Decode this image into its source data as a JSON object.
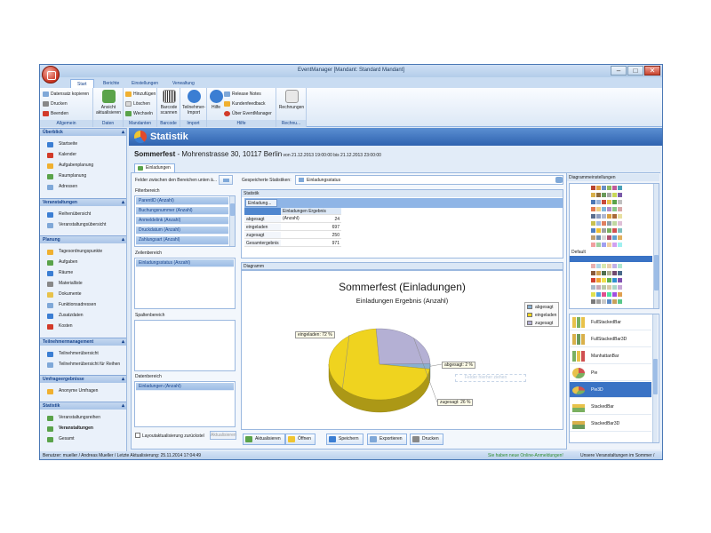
{
  "window": {
    "title": "EventManager [Mandant: Standard Mandant]",
    "min": "–",
    "max": "□",
    "close": "✕"
  },
  "ribbon": {
    "tabs": [
      "Start",
      "Berichte",
      "Einstellungen",
      "Verwaltung"
    ],
    "groups": {
      "allgemein": {
        "label": "Allgemein",
        "items": [
          "Datensatz kopieren",
          "Drucken",
          "Beenden"
        ]
      },
      "daten": {
        "label": "Daten",
        "button": "Ansicht aktualisieren"
      },
      "mandanten": {
        "label": "Mandanten",
        "items": [
          "Hinzufügen",
          "Löschen",
          "Wechseln"
        ]
      },
      "barcode": {
        "label": "Barcode",
        "button": "Barcode scannen"
      },
      "import": {
        "label": "Import",
        "button": "Teilnehmer-Import"
      },
      "hilfe": {
        "label": "Hilfe",
        "button": "Hilfe",
        "items": [
          "Release Notes",
          "Kundenfeedback",
          "Über EventManager"
        ]
      },
      "rechnungen": {
        "label": "Rechnu...",
        "button": "Rechnungen"
      }
    }
  },
  "sidebar": {
    "sections": [
      {
        "title": "Überblick",
        "items": [
          "Startseite",
          "Kalender",
          "Aufgabenplanung",
          "Raumplanung",
          "Adressen"
        ]
      },
      {
        "title": "Veranstaltungen",
        "items": [
          "Reihenübersicht",
          "Veranstaltungsübersicht"
        ]
      },
      {
        "title": "Planung",
        "items": [
          "Tagesordnungspunkte",
          "Aufgaben",
          "Räume",
          "Materialliste",
          "Dokumente",
          "Funktionsadressen",
          "Zusatzdaten",
          "Kosten"
        ]
      },
      {
        "title": "Teilnehmermanagement",
        "items": [
          "Teilnehmerübersicht",
          "Teilnehmerübersicht für Reihen"
        ]
      },
      {
        "title": "Umfrageergebnisse",
        "items": [
          "Anonyme Umfragen"
        ]
      },
      {
        "title": "Statistik",
        "items": [
          "Veranstaltungsreihen",
          "Veranstaltungen",
          "Gesamt"
        ]
      }
    ]
  },
  "page": {
    "title": "Statistik",
    "event_name": "Sommerfest",
    "event_address": " - Mohrenstrasse 30, 10117 Berlin",
    "event_date": " von 21.12.2013 19:00:00 bis 21.12.2013 23:00:00",
    "subtab": "Einladungen"
  },
  "left_panel": {
    "drag_hint": "Felder zwischen den Bereichen unten ä...",
    "filter_label": "Filterbereich",
    "filter_fields": [
      "ParentID (Anzahl)",
      "Buchungsnummer (Anzahl)",
      "Anmeldelink (Anzahl)",
      "Druckdatum (Anzahl)",
      "Zahlungsart (Anzahl)"
    ],
    "row_label": "Zeilenbereich",
    "row_fields": [
      "Einladungsstatus (Anzahl)"
    ],
    "col_label": "Spaltenbereich",
    "data_label": "Datenbereich",
    "data_fields": [
      "Einladungen (Anzahl)"
    ],
    "layout_check": "Layoutaktualisierung zurückstel",
    "update_btn": "Aktualisieren"
  },
  "saved_stats": {
    "label": "Gespeicherte Statistiken:",
    "value": "Einladungsstatus"
  },
  "stat_table": {
    "title": "Statistik",
    "corner": "Einladung...",
    "column": "Einladungen Ergebnis (Anzahl)",
    "rows": [
      {
        "label": "abgesagt",
        "value": "24"
      },
      {
        "label": "eingeladen",
        "value": "697"
      },
      {
        "label": "zugesagt",
        "value": "250"
      },
      {
        "label": "Gesamtergebnis",
        "value": "971"
      }
    ]
  },
  "diagram_panel_title": "Diagramm",
  "chart_data": {
    "type": "pie",
    "title": "Sommerfest (Einladungen)",
    "subtitle": "Einladungen Ergebnis (Anzahl)",
    "slices": [
      {
        "name": "abgesagt",
        "value": 24,
        "label": "abgesagt: 2 %",
        "color": "#8ab0cf"
      },
      {
        "name": "eingeladen",
        "value": 697,
        "label": "eingeladen: 72 %",
        "color": "#efd31f"
      },
      {
        "name": "zugesagt",
        "value": 250,
        "label": "zugesagt: 26 %",
        "color": "#b4b0d4"
      }
    ],
    "legend_placement": "top-right",
    "ghost_hint": "Felder hierher ziehen"
  },
  "actions": [
    "Aktualisieren",
    "Öffnen",
    "Speichern",
    "Exportieren",
    "Drucken"
  ],
  "diagram_settings": {
    "title": "Diagrammeinstellungen",
    "default_label": "Default",
    "types": [
      "FullStackedBar",
      "FullStackedBar3D",
      "ManhattanBar",
      "Pie",
      "Pie3D",
      "StackedBar",
      "StackedBar3D"
    ],
    "selected": "Pie3D"
  },
  "status": {
    "left": "Benutzer: mueller / Andreas Mueller / Letzte Aktualisierung: 25.11.2014 17:04:49",
    "middle": "Sie haben neue Online-Anmeldungen!",
    "right": "Unsere Veranstaltungen im Sommer / Sommerfest"
  },
  "colors": {
    "accent": "#2f63b0",
    "selection": "#3a73c5",
    "pie_yellow": "#efd31f",
    "pie_lilac": "#b4b0d4",
    "pie_blue": "#8ab0cf"
  }
}
